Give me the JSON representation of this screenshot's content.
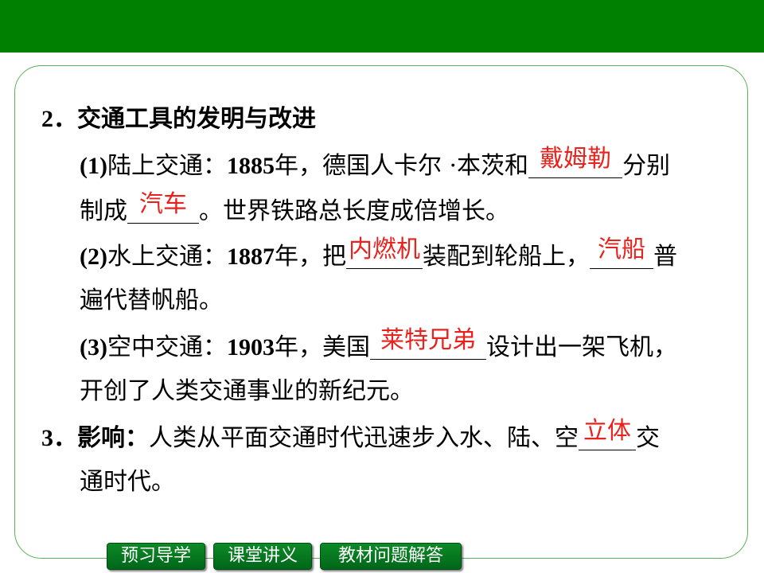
{
  "section2": {
    "number": "2．",
    "title": "交通工具的发明与改进",
    "land": {
      "label": "(1)",
      "l1_part1": "陆上交通：",
      "year": "1885",
      "l1_part2": "年，德国人卡尔 ·本茨和",
      "answer1": "戴姆勒",
      "l1_part3": "分别",
      "l2_part1": "制成",
      "answer2": "汽车",
      "l2_part2": "。世界铁路总长度成倍增长。"
    },
    "water": {
      "label": "(2)",
      "l1_part1": "水上交通：",
      "year": "1887",
      "l1_part2": "年，把",
      "answer1": "内燃机",
      "l1_part3": "装配到轮船上，",
      "answer2": "汽船",
      "l1_part4": "普",
      "l2": "遍代替帆船。"
    },
    "air": {
      "label": "(3)",
      "l1_part1": "空中交通：",
      "year": "1903",
      "l1_part2": "年，美国",
      "answer1": "莱特兄弟",
      "l1_part3": "设计出一架飞机，",
      "l2": "开创了人类交通事业的新纪元。"
    }
  },
  "section3": {
    "number": "3．",
    "title": "影响：",
    "l1_part1": "人类从平面交通时代迅速步入水、陆、空",
    "answer1": "立体",
    "l1_part2": "交",
    "l2": "通时代。"
  },
  "nav": {
    "btn1": "预习导学",
    "btn2": "课堂讲义",
    "btn3": "教材问题解答"
  },
  "colors": {
    "top_bar": "#008000",
    "answer": "#e8231e",
    "nav_button": "#007a1f"
  }
}
